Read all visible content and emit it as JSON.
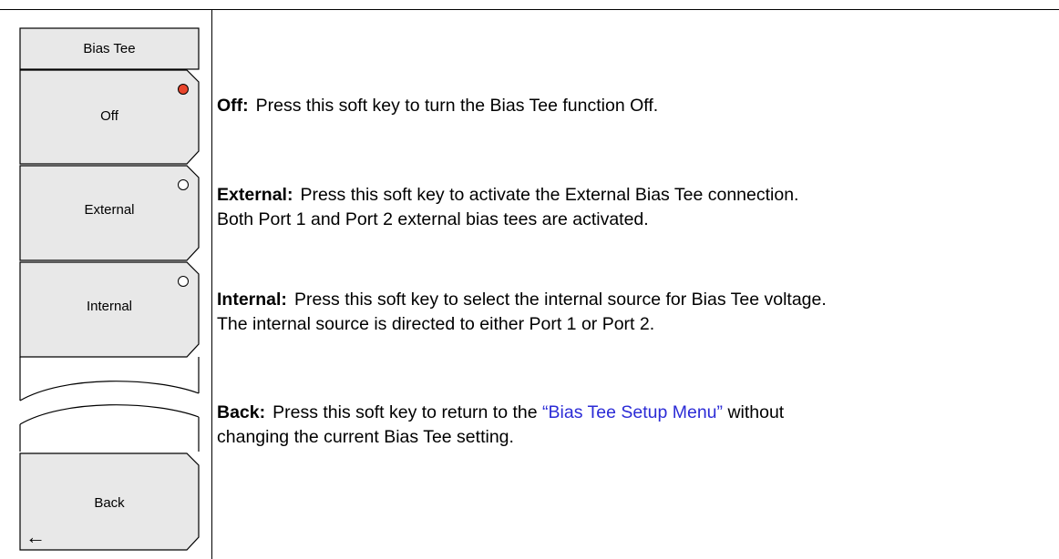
{
  "menu": {
    "title": "Bias Tee",
    "keys": [
      {
        "label": "Off",
        "selected": true
      },
      {
        "label": "External",
        "selected": false
      },
      {
        "label": "Internal",
        "selected": false
      }
    ],
    "back_label": "Back",
    "back_arrow": "←"
  },
  "descriptions": {
    "off": {
      "term": "Off:",
      "text": "Press this soft key to turn the Bias Tee function Off."
    },
    "external": {
      "term": "External:",
      "line1": "Press this soft key to activate the External Bias Tee connection.",
      "line2": "Both Port 1 and Port 2 external bias tees are activated."
    },
    "internal": {
      "term": "Internal:",
      "line1": "Press this soft key to select the internal source for Bias Tee voltage.",
      "line2": "The internal source is directed to either Port 1 or Port 2."
    },
    "back": {
      "term": "Back:",
      "text_before": "Press this soft key to return to the",
      "link": "“Bias Tee Setup Menu”",
      "text_after": "without",
      "line2": "changing the current Bias Tee setting."
    }
  },
  "colors": {
    "selected_radio": "#e8452c",
    "key_fill": "#e8e8e8",
    "link": "#2b2bd6"
  }
}
